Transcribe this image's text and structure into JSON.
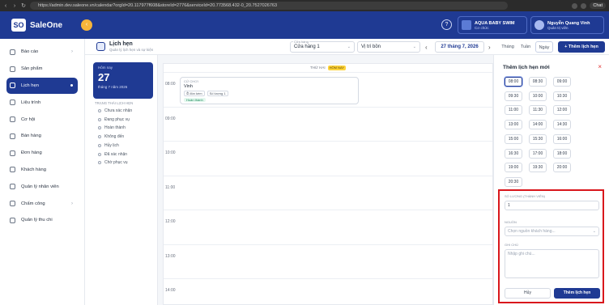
{
  "browser": {
    "url": "https://admin.dev.saleone.vn/calendar?orgId=20.117977f608&storeId=2776&serviceId=20.773568.432-0_20.7527026763",
    "chat_label": "Chat"
  },
  "app": {
    "logo_mark": "SO",
    "logo_text": "SaleOne"
  },
  "accounts": [
    {
      "name": "AQUA BABY SWIM",
      "sub": "Cơ chức"
    },
    {
      "name": "Nguyễn Quang Vinh",
      "sub": "Quản trị viên"
    }
  ],
  "sidebar": {
    "items": [
      {
        "label": "Báo cáo",
        "icon": "report-icon",
        "chevron": true
      },
      {
        "label": "Sản phẩm",
        "icon": "product-icon"
      },
      {
        "label": "Lịch hẹn",
        "icon": "calendar-icon",
        "active": true
      },
      {
        "label": "Liệu trình",
        "icon": "treatment-icon"
      },
      {
        "label": "Cơ hội",
        "icon": "opportunity-icon"
      },
      {
        "label": "Bán hàng",
        "icon": "sales-icon"
      },
      {
        "label": "Đơn hàng",
        "icon": "order-icon"
      },
      {
        "label": "Khách hàng",
        "icon": "customer-icon"
      },
      {
        "label": "Quản lý nhân viên",
        "icon": "staff-icon"
      },
      {
        "label": "Chấm công",
        "icon": "timesheet-icon",
        "chevron": true
      },
      {
        "label": "Quản lý thu chi",
        "icon": "finance-icon"
      }
    ]
  },
  "header": {
    "title": "Lịch hẹn",
    "subtitle": "Quản lý lịch hẹn và sự kiện",
    "store_label": "Cửa hàng",
    "store_value": "Cửa hàng 1",
    "location_value": "Vị trí bồn",
    "date": "27 tháng 7, 2026",
    "views": [
      "Tháng",
      "Tuần",
      "Ngày"
    ],
    "add_label": "Thêm lịch hẹn"
  },
  "mini": {
    "today_label": "Hôm nay",
    "today_day": "27",
    "today_date": "tháng 7 năm 2026",
    "legend_title": "TRẠNG THÁI LỊCH HẸN",
    "statuses": [
      "Chưa xác nhận",
      "Đang phục vụ",
      "Hoàn thành",
      "Không đến",
      "Hủy lịch",
      "Đã xác nhận",
      "Chờ phục vụ"
    ]
  },
  "calendar": {
    "day_header": "THỨ HAI",
    "today_tag": "HÔM NAY",
    "hours": [
      "08:00",
      "09:00",
      "10:00",
      "11:00",
      "12:00",
      "13:00",
      "14:00"
    ],
    "appointment": {
      "time": "CỬ CHƠI",
      "customer": "Vinh",
      "service_chip": "đón kèm",
      "qty_chip": "Số lượng 1",
      "status": "Hoàn thành"
    }
  },
  "panel": {
    "title": "Thêm lịch hẹn mới",
    "slots": [
      "08:00",
      "08:30",
      "09:00",
      "09:30",
      "10:00",
      "10:30",
      "11:00",
      "11:30",
      "12:00",
      "13:00",
      "14:00",
      "14:30",
      "15:00",
      "15:30",
      "16:00",
      "16:30",
      "17:00",
      "18:00",
      "19:00",
      "19:30",
      "20:00",
      "20:30"
    ],
    "selected_slot": "08:00",
    "qty_label": "SỐ LƯỢNG (THÀNH VIÊN)",
    "qty_value": "1",
    "source_label": "NGUỒN",
    "source_placeholder": "Chọn nguồn khách hàng...",
    "note_label": "GHI CHÚ",
    "note_placeholder": "Nhập ghi chú...",
    "cancel_label": "Hủy",
    "submit_label": "Thêm lịch hẹn"
  },
  "colors": {
    "primary": "#1f3a93",
    "accent": "#f7b53a",
    "highlight_border": "#d9171c"
  }
}
